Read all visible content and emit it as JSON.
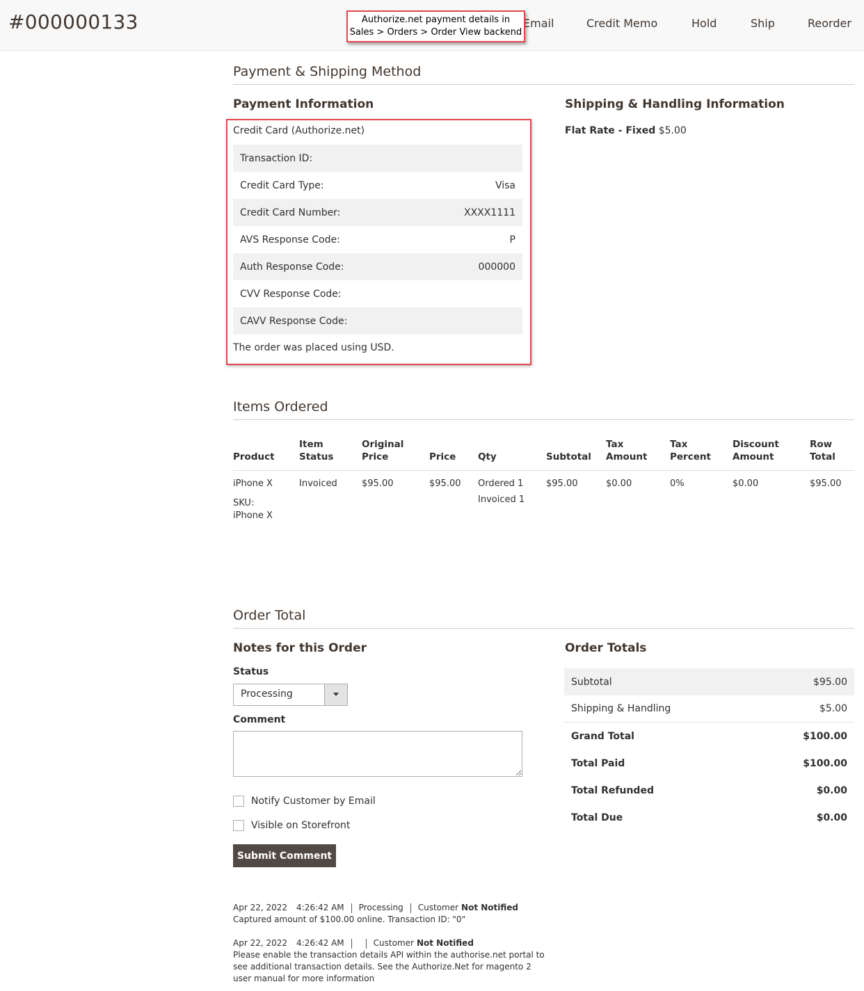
{
  "header": {
    "order_number": "#000000133",
    "nav": [
      {
        "label": "Email"
      },
      {
        "label": "Credit Memo"
      },
      {
        "label": "Hold"
      },
      {
        "label": "Ship"
      },
      {
        "label": "Reorder"
      }
    ],
    "callout_line1": "Authorize.net payment details in",
    "callout_line2": "Sales > Orders > Order View backend"
  },
  "payment_shipping": {
    "section_title": "Payment & Shipping Method",
    "payment_title": "Payment Information",
    "method": "Credit Card (Authorize.net)",
    "rows": [
      {
        "label": "Transaction ID:",
        "value": ""
      },
      {
        "label": "Credit Card Type:",
        "value": "Visa"
      },
      {
        "label": "Credit Card Number:",
        "value": "XXXX1111"
      },
      {
        "label": "AVS Response Code:",
        "value": "P"
      },
      {
        "label": "Auth Response Code:",
        "value": "000000"
      },
      {
        "label": "CVV Response Code:",
        "value": ""
      },
      {
        "label": "CAVV Response Code:",
        "value": ""
      }
    ],
    "currency_note": "The order was placed using USD.",
    "shipping_title": "Shipping & Handling Information",
    "shipping_method": "Flat Rate - Fixed",
    "shipping_price": "$5.00"
  },
  "items": {
    "section_title": "Items Ordered",
    "headers": {
      "product": "Product",
      "item_status_1": "Item",
      "item_status_2": "Status",
      "original_price_1": "Original",
      "original_price_2": "Price",
      "price": "Price",
      "qty": "Qty",
      "subtotal": "Subtotal",
      "tax_amount_1": "Tax",
      "tax_amount_2": "Amount",
      "tax_percent_1": "Tax",
      "tax_percent_2": "Percent",
      "discount_1": "Discount",
      "discount_2": "Amount",
      "row_total_1": "Row",
      "row_total_2": "Total"
    },
    "row": {
      "product": "iPhone X",
      "sku_label": "SKU:",
      "sku": "iPhone X",
      "item_status": "Invoiced",
      "original_price": "$95.00",
      "price": "$95.00",
      "qty_ordered": "Ordered 1",
      "qty_invoiced": "Invoiced 1",
      "subtotal": "$95.00",
      "tax_amount": "$0.00",
      "tax_percent": "0%",
      "discount": "$0.00",
      "row_total": "$95.00"
    }
  },
  "order_total": {
    "section_title": "Order Total",
    "notes_title": "Notes for this Order",
    "status_label": "Status",
    "status_value": "Processing",
    "comment_label": "Comment",
    "notify_label": "Notify Customer by Email",
    "visible_label": "Visible on Storefront",
    "submit_label": "Submit Comment",
    "history": [
      {
        "date": "Apr 22, 2022",
        "time": "4:26:42 AM",
        "status": "Processing",
        "customer": "Customer",
        "notified": "Not Notified",
        "text": "Captured amount of $100.00 online. Transaction ID: \"0\""
      },
      {
        "date": "Apr 22, 2022",
        "time": "4:26:42 AM",
        "status": "",
        "customer": "Customer",
        "notified": "Not Notified",
        "text_1": "Please enable the transaction details API within the authorise.net portal to",
        "text_2": "see additional transaction details. See the Authorize.Net for magento 2",
        "text_3": "user manual for more information"
      }
    ],
    "totals_title": "Order Totals",
    "totals": [
      {
        "label": "Subtotal",
        "value": "$95.00"
      },
      {
        "label": "Shipping & Handling",
        "value": "$5.00"
      },
      {
        "label": "Grand Total",
        "value": "$100.00"
      },
      {
        "label": "Total Paid",
        "value": "$100.00"
      },
      {
        "label": "Total Refunded",
        "value": "$0.00"
      },
      {
        "label": "Total Due",
        "value": "$0.00"
      }
    ]
  }
}
